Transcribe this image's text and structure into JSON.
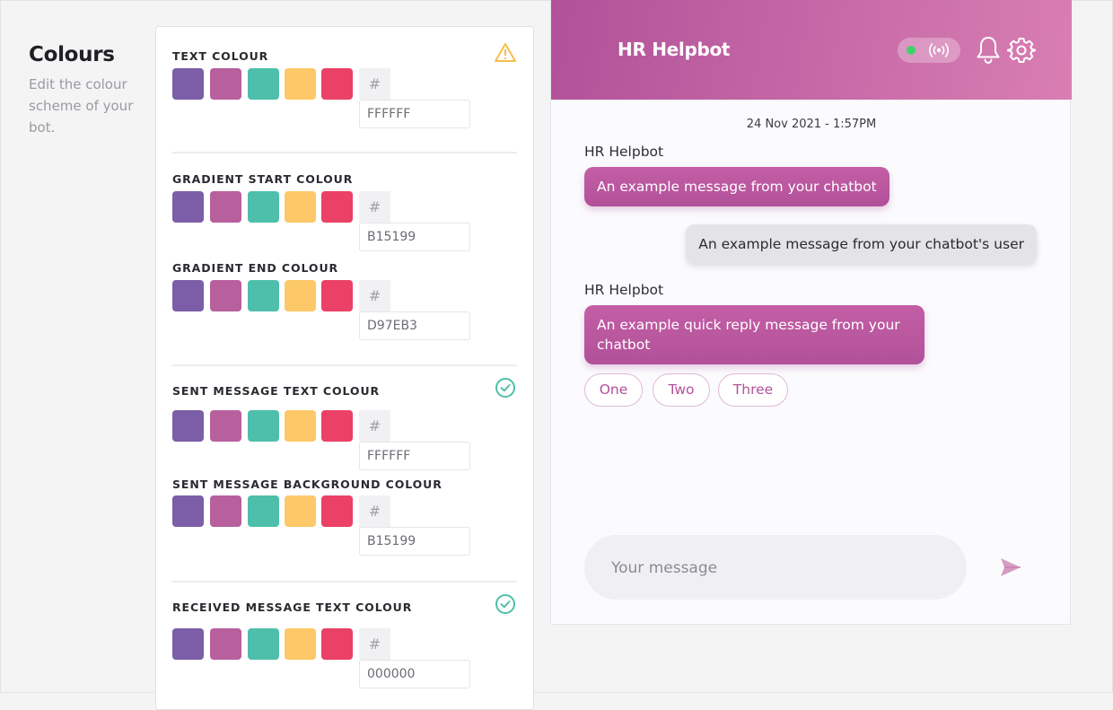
{
  "intro": {
    "title": "Colours",
    "description": "Edit the colour scheme of your bot."
  },
  "palette": [
    "#7B5EA7",
    "#B8609E",
    "#4EBFAB",
    "#FDC868",
    "#EB4167"
  ],
  "status_colors": {
    "warning": "#F6BF4A",
    "ok": "#4EBFAB"
  },
  "fields": {
    "text_colour": {
      "label": "TEXT COLOUR",
      "hash": "#",
      "value": "FFFFFF",
      "status": "warning-icon"
    },
    "gradient_start": {
      "label": "GRADIENT START COLOUR",
      "hash": "#",
      "value": "B15199"
    },
    "gradient_end": {
      "label": "GRADIENT END COLOUR",
      "hash": "#",
      "value": "D97EB3"
    },
    "sent_text": {
      "label": "SENT MESSAGE TEXT COLOUR",
      "hash": "#",
      "value": "FFFFFF",
      "status": "check-circle-icon"
    },
    "sent_bg": {
      "label": "SENT MESSAGE BACKGROUND COLOUR",
      "hash": "#",
      "value": "B15199"
    },
    "received_text": {
      "label": "RECEIVED MESSAGE TEXT COLOUR",
      "hash": "#",
      "value": "000000",
      "status": "check-circle-icon"
    }
  },
  "chat": {
    "bot_name": "HR Helpbot",
    "online_status_color": "#3DD46B",
    "gradient": {
      "start": "#B15199",
      "end": "#D97EB3"
    },
    "timestamp": "24 Nov 2021 - 1:57PM",
    "messages": [
      {
        "sender": "HR Helpbot",
        "text": "An example message from your chatbot"
      },
      {
        "text": "An example message from your chatbot's user"
      },
      {
        "sender": "HR Helpbot",
        "text": "An example quick reply message from your chatbot"
      }
    ],
    "quick_replies": [
      "One",
      "Two",
      "Three"
    ],
    "composer_placeholder": "Your message"
  }
}
